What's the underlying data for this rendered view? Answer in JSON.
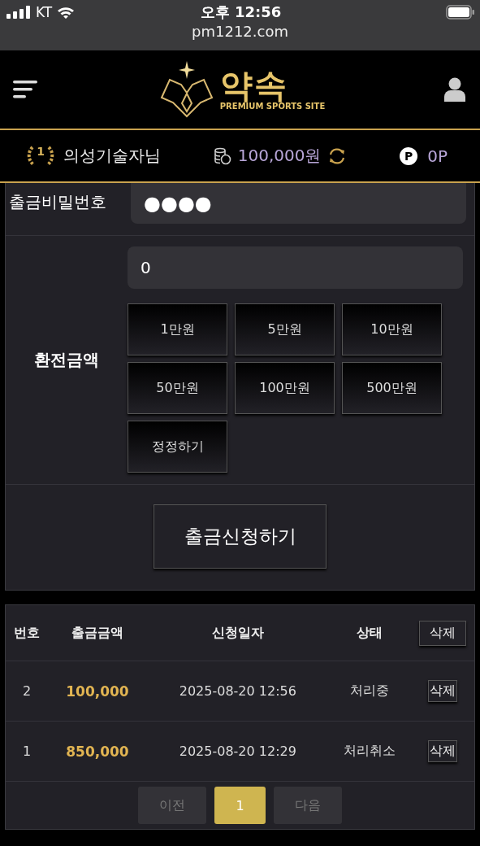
{
  "status_bar": {
    "carrier": "KT",
    "time": "오후 12:56",
    "url": "pm1212.com"
  },
  "header": {
    "logo_title": "약속",
    "logo_subtitle": "PREMIUM SPORTS SITE"
  },
  "user_bar": {
    "rank": "1",
    "username": "의성기술자님",
    "balance": "100,000원",
    "points": "0P",
    "points_badge": "P"
  },
  "form": {
    "password_label": "출금비밀번호",
    "password_value": "●●●●",
    "amount_label": "환전금액",
    "amount_value": "0",
    "amount_buttons": [
      "1만원",
      "5만원",
      "10만원",
      "50만원",
      "100만원",
      "500만원",
      "정정하기"
    ],
    "submit": "출금신청하기"
  },
  "table": {
    "columns": [
      "번호",
      "출금금액",
      "신청일자",
      "상태"
    ],
    "delete_all": "삭제",
    "rows": [
      {
        "no": "2",
        "amount": "100,000",
        "date": "2025-08-20 12:56",
        "status": "처리중",
        "delete": "삭제"
      },
      {
        "no": "1",
        "amount": "850,000",
        "date": "2025-08-20 12:29",
        "status": "처리취소",
        "delete": "삭제"
      }
    ]
  },
  "pagination": [
    {
      "label": "이전",
      "selected": false
    },
    {
      "label": "1",
      "selected": true
    },
    {
      "label": "다음",
      "selected": false
    }
  ]
}
